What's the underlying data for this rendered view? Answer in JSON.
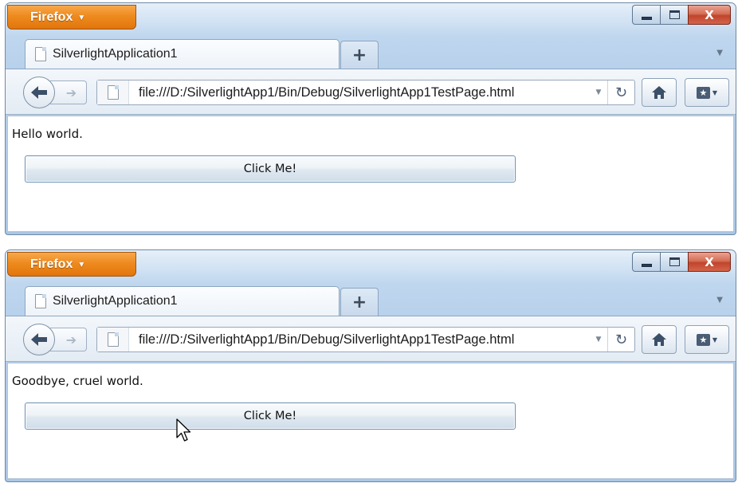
{
  "windows": [
    {
      "app_button": "Firefox",
      "tab_title": "SilverlightApplication1",
      "new_tab": "+",
      "url": "file:///D:/SilverlightApp1/Bin/Debug/SilverlightApp1TestPage.html",
      "close": "X",
      "message": "Hello world.",
      "button_label": "Click Me!"
    },
    {
      "app_button": "Firefox",
      "tab_title": "SilverlightApplication1",
      "new_tab": "+",
      "url": "file:///D:/SilverlightApp1/Bin/Debug/SilverlightApp1TestPage.html",
      "close": "X",
      "message": "Goodbye, cruel world.",
      "button_label": "Click Me!"
    }
  ],
  "icons": [
    "firefox-menu-caret-icon",
    "minimize-icon",
    "maximize-icon",
    "close-icon",
    "page-icon",
    "back-arrow-icon",
    "forward-arrow-icon",
    "reload-icon",
    "home-icon",
    "bookmarks-icon",
    "mouse-cursor-icon"
  ],
  "colors": {
    "firefox_orange": "#e2760c",
    "chrome_blue": "#b7d0eb",
    "close_red": "#c1442c",
    "button_border": "#6a90b3"
  }
}
